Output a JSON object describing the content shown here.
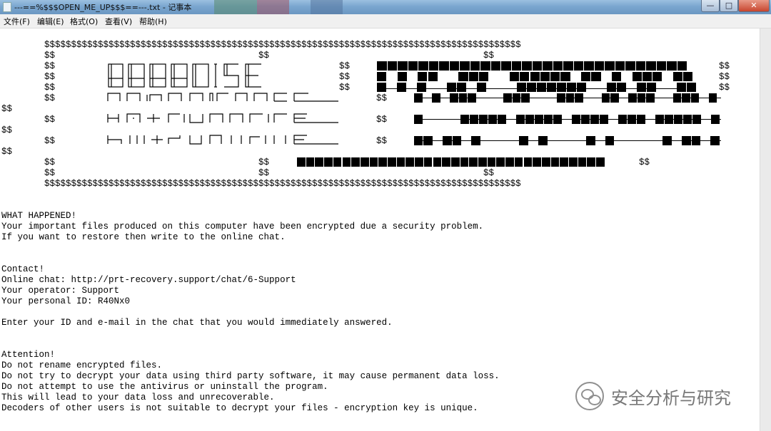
{
  "window": {
    "title": "---==%$$$OPEN_ME_UP$$$==---.txt - 记事本",
    "buttons": {
      "minimize": "—",
      "maximize": "□",
      "close": "✕"
    }
  },
  "menu": [
    "文件(F)",
    "编辑(E)",
    "格式(O)",
    "查看(V)",
    "帮助(H)"
  ],
  "banner": {
    "border": "$$$$$$$$$$$$$$$$$$$$$$$$$$$$$$$$$$$$$$$$$$$$$$$$$$$$$$$$$$$$$$$$$$$$$$$$$$$$$$$$$$$$$$$$$",
    "dollar_mark": "$$",
    "ascii_words": [
      "PARADISE",
      "RANSOMWARE"
    ]
  },
  "note": {
    "lines": [
      "WHAT HAPPENED!",
      "Your important files produced on this computer have been encrypted due a security problem.",
      "If you want to restore then write to the online chat.",
      "",
      "",
      "Contact!",
      "Online chat: http://prt-recovery.support/chat/6-Support",
      "Your operator: Support",
      "Your personal ID: R40Nx0",
      "",
      "Enter your ID and e-mail in the chat that you would immediately answered.",
      "",
      "",
      "Attention!",
      "Do not rename encrypted files.",
      "Do not try to decrypt your data using third party software, it may cause permanent data loss.",
      "Do not attempt to use the antivirus or uninstall the program.",
      "This will lead to your data loss and unrecoverable.",
      "Decoders of other users is not suitable to decrypt your files - encryption key is unique."
    ]
  },
  "watermark": {
    "text": "安全分析与研究",
    "icon": "wechat-icon"
  }
}
